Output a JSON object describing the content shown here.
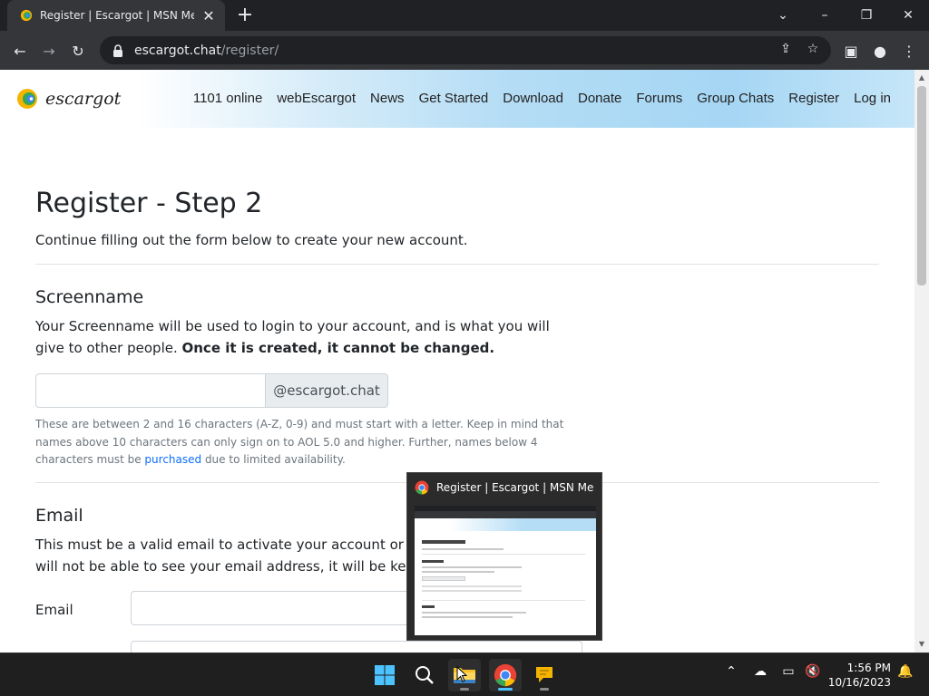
{
  "browser": {
    "tab_title": "Register | Escargot | MSN Messe",
    "new_tab_label": "+",
    "url_host": "escargot.chat",
    "url_path": "/register/"
  },
  "site": {
    "brand": "escargot",
    "nav": [
      "1101 online",
      "webEscargot",
      "News",
      "Get Started",
      "Download",
      "Donate",
      "Forums",
      "Group Chats",
      "Register",
      "Log in"
    ]
  },
  "page": {
    "title": "Register - Step 2",
    "lead": "Continue filling out the form below to create your new account.",
    "screenname": {
      "heading": "Screenname",
      "desc_plain": "Your Screenname will be used to login to your account, and is what you will give to other people. ",
      "desc_bold": "Once it is created, it cannot be changed.",
      "input_value": "",
      "addon": "@escargot.chat",
      "help_before": "These are between 2 and 16 characters (A-Z, 0-9) and must start with a letter. Keep in mind that names above 10 characters can only sign on to AOL 5.0 and higher. Further, names below 4 characters must be ",
      "help_link": "purchased",
      "help_after": " due to limited availability."
    },
    "email": {
      "heading": "Email",
      "desc_line1": "This must be a valid email to activate your account or it ca",
      "desc_line2": "will not be able to see your email address, it will be kept ",
      "desc_link": "p",
      "label": "Email",
      "input_value": ""
    }
  },
  "preview": {
    "title": "Register | Escargot | MSN Messe..."
  },
  "taskbar": {
    "time": "1:56 PM",
    "date": "10/16/2023",
    "colors": {
      "accent": "#4cc2ff",
      "chrome_red": "#ea4335",
      "chrome_green": "#34a853",
      "chrome_yellow": "#fbbc05",
      "chrome_blue": "#4285f4"
    }
  }
}
